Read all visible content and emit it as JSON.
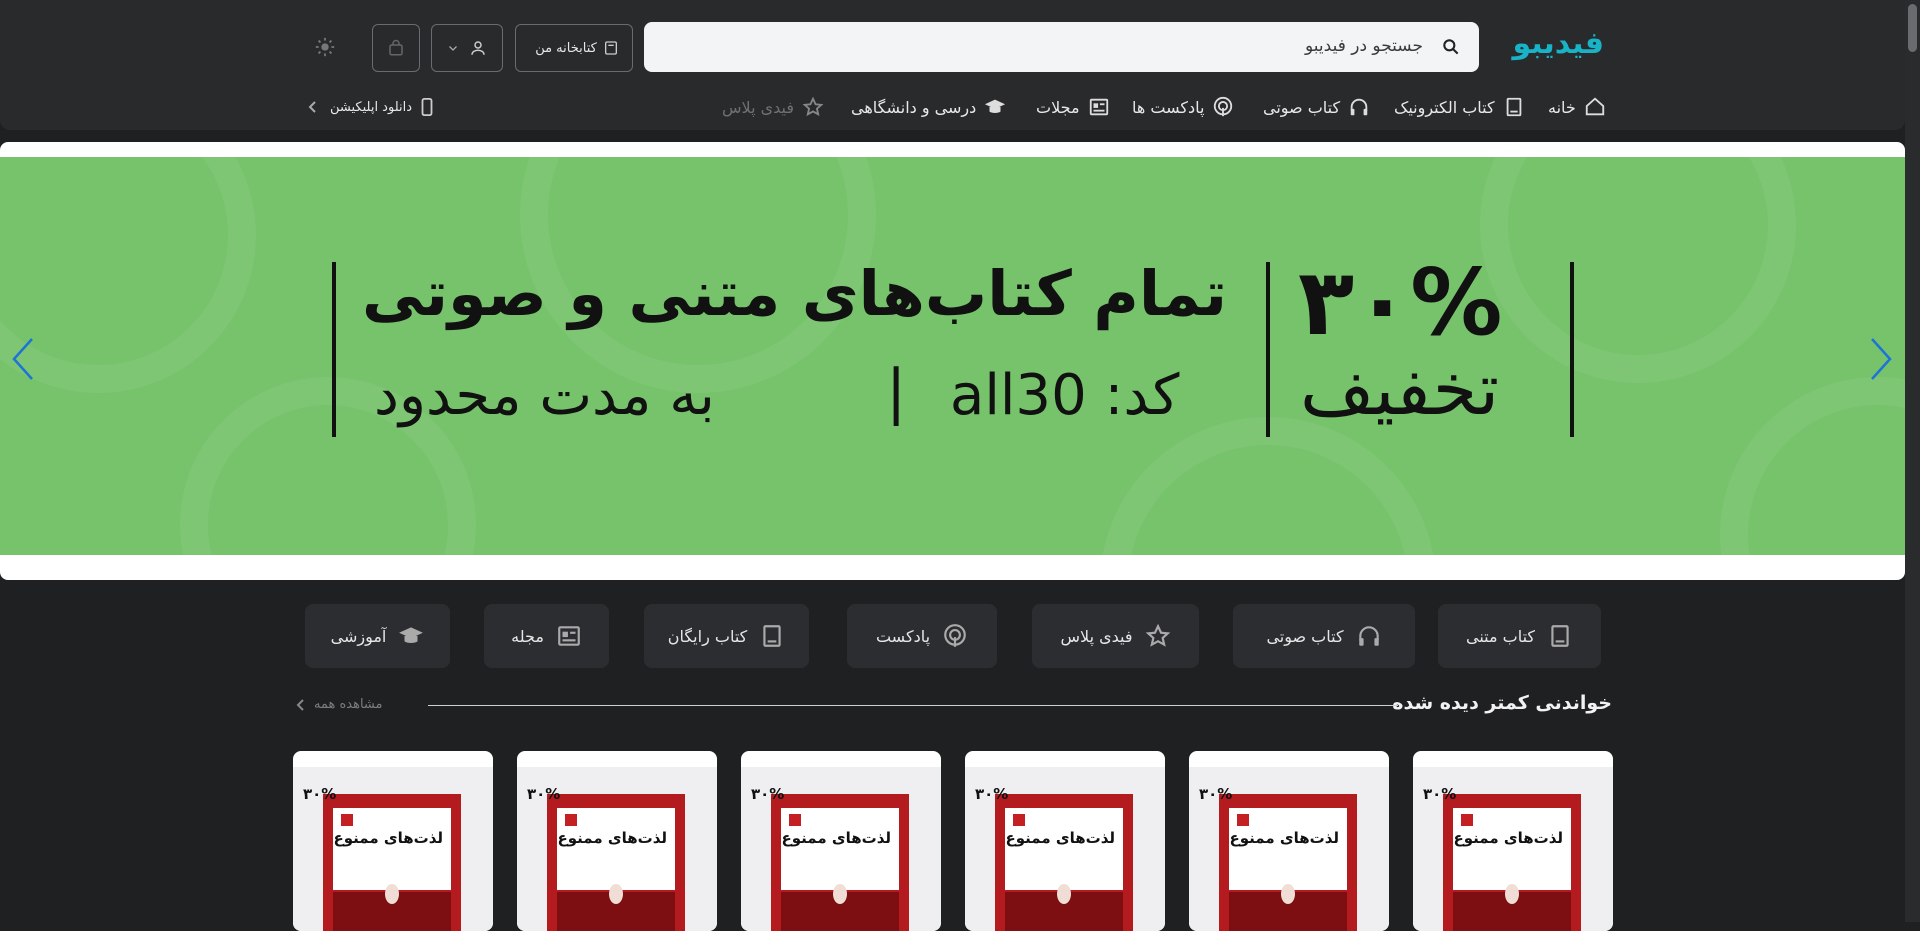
{
  "brand": {
    "logo_text": "فیدیبو",
    "accent": "#19b3c8"
  },
  "search": {
    "placeholder": "جستجو در فیدیبو"
  },
  "header": {
    "library_label": "کتابخانه من",
    "download_app_label": "دانلود اپلیکیشن"
  },
  "nav": [
    {
      "label": "خانه",
      "icon": "home-icon"
    },
    {
      "label": "کتاب الکترونیک",
      "icon": "book-icon"
    },
    {
      "label": "کتاب صوتی",
      "icon": "headphones-icon"
    },
    {
      "label": "پادکست ها",
      "icon": "podcast-icon"
    },
    {
      "label": "مجلات",
      "icon": "newspaper-icon"
    },
    {
      "label": "درسی و دانشگاهی",
      "icon": "graduation-cap-icon"
    },
    {
      "label": "فیدی پلاس",
      "icon": "star-icon"
    }
  ],
  "banner": {
    "percent": "۳۰%",
    "discount_word": "تخفیف",
    "headline": "تمام کتاب‌های متنی و صوتی",
    "code_label": "کد: all30",
    "separator": "|",
    "duration": "به مدت محدود",
    "background": "#76c36c"
  },
  "categories": [
    {
      "label": "کتاب متنی",
      "icon": "book-icon"
    },
    {
      "label": "کتاب صوتی",
      "icon": "headphones-icon"
    },
    {
      "label": "فیدی پلاس",
      "icon": "star-icon"
    },
    {
      "label": "پادکست",
      "icon": "podcast-icon"
    },
    {
      "label": "کتاب رایگان",
      "icon": "book-icon"
    },
    {
      "label": "مجله",
      "icon": "newspaper-icon"
    },
    {
      "label": "آموزشی",
      "icon": "graduation-cap-icon"
    }
  ],
  "section": {
    "title": "خواندنی کمتر دیده شده",
    "see_all": "مشاهده همه"
  },
  "books": [
    {
      "badge": "۳۰%",
      "cover_title": "لذت‌های ممنوع"
    },
    {
      "badge": "۳۰%",
      "cover_title": "لذت‌های ممنوع"
    },
    {
      "badge": "۳۰%",
      "cover_title": "لذت‌های ممنوع"
    },
    {
      "badge": "۳۰%",
      "cover_title": "لذت‌های ممنوع"
    },
    {
      "badge": "۳۰%",
      "cover_title": "لذت‌های ممنوع"
    },
    {
      "badge": "۳۰%",
      "cover_title": "لذت‌های ممنوع"
    }
  ]
}
